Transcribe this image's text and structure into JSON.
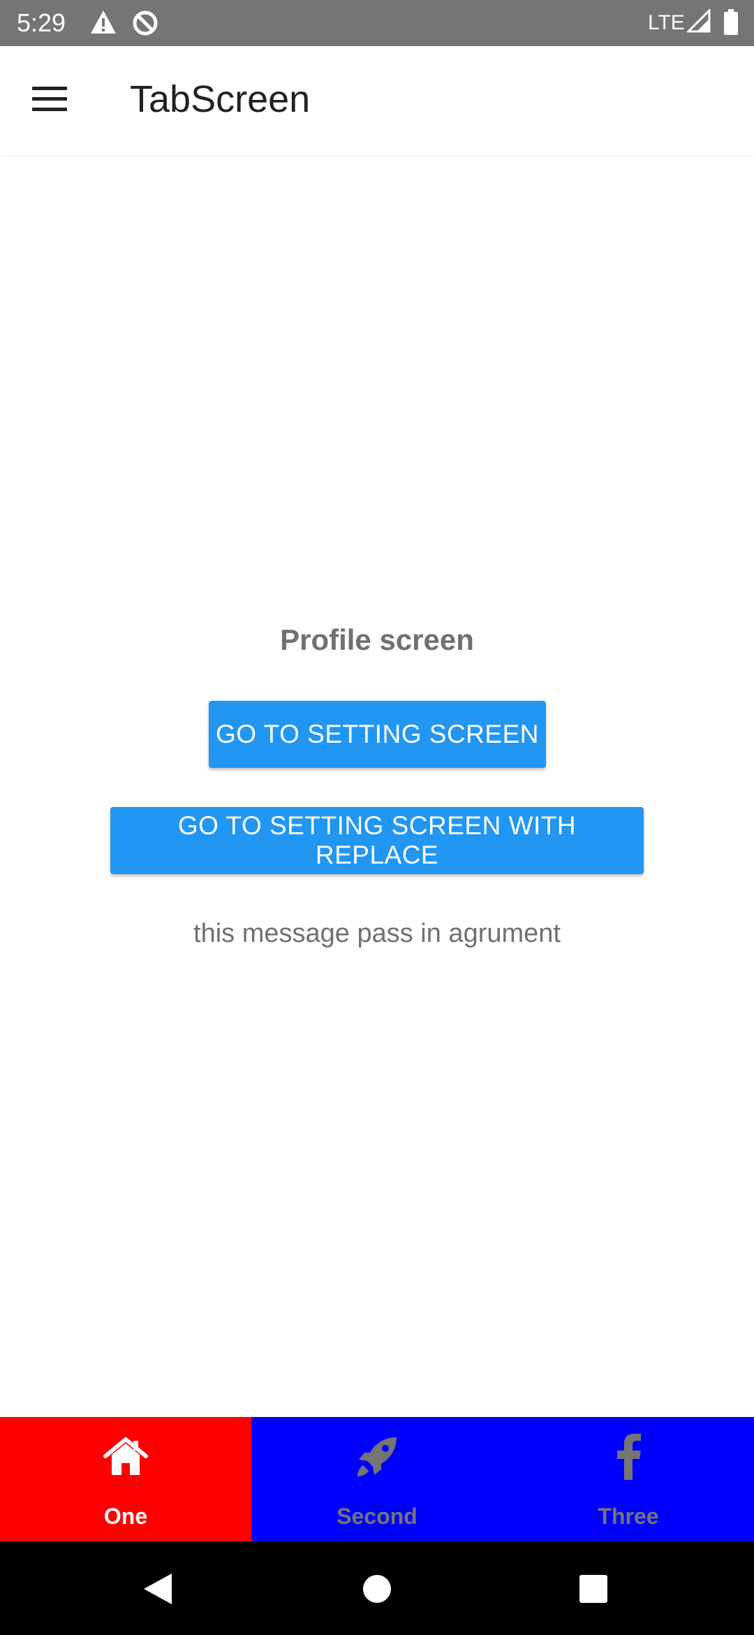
{
  "status_bar": {
    "time": "5:29",
    "network": "LTE",
    "icons": [
      "warning-icon",
      "data-saver-icon",
      "signal-icon",
      "battery-icon"
    ]
  },
  "app_bar": {
    "title": "TabScreen",
    "menu_icon": "hamburger-menu-icon"
  },
  "main": {
    "heading": "Profile screen",
    "setting_button_label": "GO TO SETTING SCREEN",
    "replace_button_label": "GO TO SETTING SCREEN WITH REPLACE",
    "message": "this message pass in agrument",
    "button_color": "#2196F3"
  },
  "tabs": [
    {
      "label": "One",
      "icon": "home-icon",
      "background": "#FF0000",
      "label_color": "#FFFFFF",
      "active": true
    },
    {
      "label": "Second",
      "icon": "rocket-icon",
      "background": "#0000FF",
      "label_color": "#757575",
      "active": false
    },
    {
      "label": "Three",
      "icon": "facebook-icon",
      "background": "#0000FF",
      "label_color": "#757575",
      "active": false
    }
  ],
  "nav_bar": {
    "buttons": [
      "back-icon",
      "home-circle-icon",
      "recents-icon"
    ]
  }
}
